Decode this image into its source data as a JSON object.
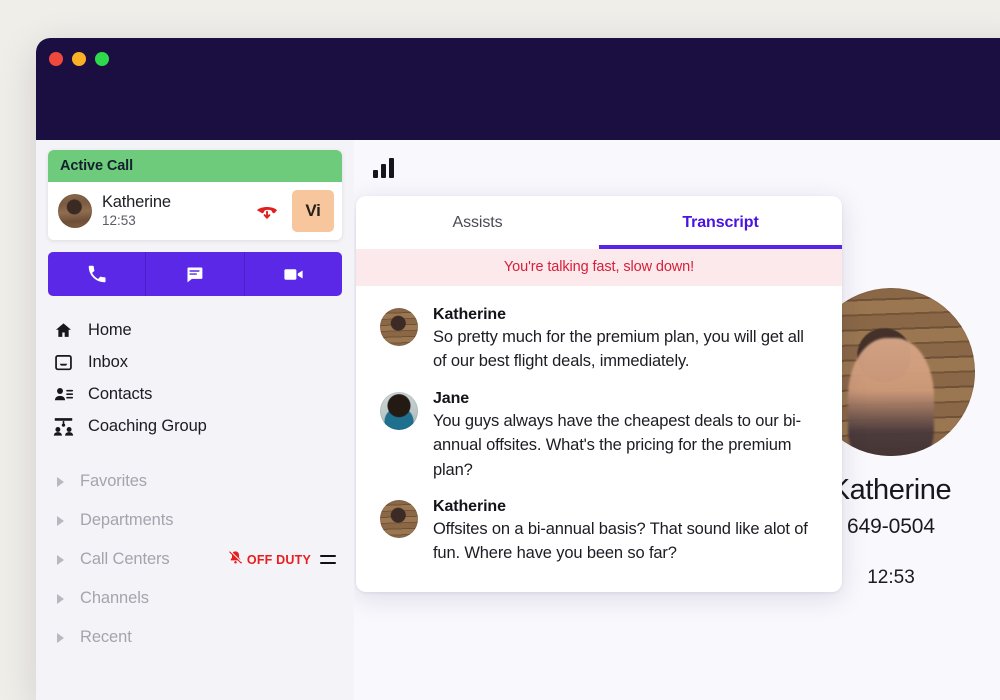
{
  "window": {
    "traffic_lights": [
      "close",
      "minimize",
      "maximize"
    ],
    "colors": {
      "titlebar": "#1B0E40",
      "accent_purple": "#5B28E8",
      "tab_active": "#4B13E0",
      "active_call_green": "#6ECB7C",
      "alert_bg": "#FCE9EC",
      "alert_text": "#D61F3A",
      "off_duty_red": "#E81E1E",
      "vi_badge_bg": "#F7C69C",
      "page_bg": "#F0EEE9",
      "sidebar_bg": "#F4F3F7",
      "main_bg": "#F9F8FD"
    }
  },
  "sidebar": {
    "active_call": {
      "header_label": "Active Call",
      "caller_name": "Katherine",
      "call_duration": "12:53",
      "hangup_icon": "phone-hangup-icon",
      "badge_label": "Vi",
      "avatar_icon": "caller-avatar"
    },
    "action_buttons": [
      {
        "name": "call-button",
        "icon": "phone-icon"
      },
      {
        "name": "message-button",
        "icon": "chat-bubble-icon"
      },
      {
        "name": "video-button",
        "icon": "video-camera-icon"
      }
    ],
    "nav_items": [
      {
        "label": "Home",
        "icon": "home-icon"
      },
      {
        "label": "Inbox",
        "icon": "inbox-icon"
      },
      {
        "label": "Contacts",
        "icon": "contacts-icon"
      },
      {
        "label": "Coaching Group",
        "icon": "coaching-group-icon"
      }
    ],
    "groups": [
      {
        "label": "Favorites",
        "icon": "chevron-right-icon",
        "badge": null
      },
      {
        "label": "Departments",
        "icon": "chevron-right-icon",
        "badge": null
      },
      {
        "label": "Call Centers",
        "icon": "chevron-right-icon",
        "badge": "OFF DUTY"
      },
      {
        "label": "Channels",
        "icon": "chevron-right-icon",
        "badge": null
      },
      {
        "label": "Recent",
        "icon": "chevron-right-icon",
        "badge": null
      }
    ],
    "off_duty": {
      "label": "OFF DUTY",
      "bell_icon": "bell-muted-icon",
      "handle_icon": "drag-handle-icon"
    }
  },
  "main": {
    "signal_icon": "signal-bars-icon",
    "contact": {
      "name": "Katherine",
      "phone": "649-0504",
      "timer": "12:53",
      "photo_icon": "contact-photo"
    }
  },
  "transcript": {
    "tabs": [
      {
        "label": "Assists",
        "active": false
      },
      {
        "label": "Transcript",
        "active": true
      }
    ],
    "alert": "You're talking fast, slow down!",
    "messages": [
      {
        "author": "Katherine",
        "avatar": "katherine-avatar",
        "text": "So pretty much for the premium plan, you will get all of our best flight deals, immediately."
      },
      {
        "author": "Jane",
        "avatar": "jane-avatar",
        "text": "You guys always have the cheapest deals to our bi-annual offsites. What's the pricing for the premium plan?"
      },
      {
        "author": "Katherine",
        "avatar": "katherine-avatar",
        "text": "Offsites on a bi-annual basis? That sound like alot of fun. Where have you been so far?"
      }
    ]
  }
}
